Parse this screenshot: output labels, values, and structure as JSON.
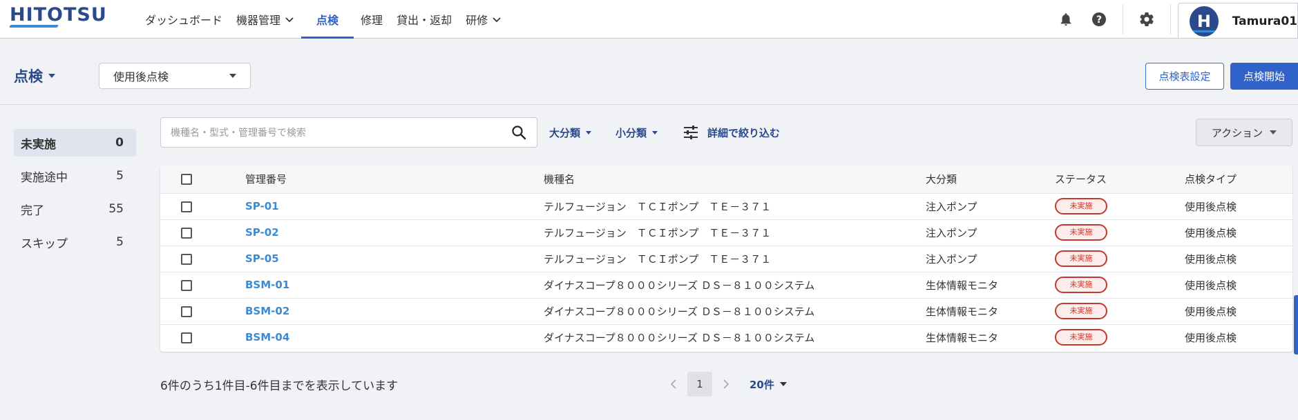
{
  "app": {
    "logo": "HITOTSU"
  },
  "nav": {
    "items": [
      {
        "label": "ダッシュボード",
        "dropdown": false,
        "active": false
      },
      {
        "label": "機器管理",
        "dropdown": true,
        "active": false
      },
      {
        "label": "点検",
        "dropdown": false,
        "active": true
      },
      {
        "label": "修理",
        "dropdown": false,
        "active": false
      },
      {
        "label": "貸出・返却",
        "dropdown": false,
        "active": false
      },
      {
        "label": "研修",
        "dropdown": true,
        "active": false
      }
    ]
  },
  "user": {
    "initial": "H",
    "name": "Tamura01"
  },
  "subheader": {
    "title": "点検",
    "inspection_type": "使用後点検",
    "settings_button": "点検表設定",
    "start_button": "点検開始"
  },
  "sidebar": {
    "items": [
      {
        "label": "未実施",
        "count": "0",
        "active": true
      },
      {
        "label": "実施途中",
        "count": "5",
        "active": false
      },
      {
        "label": "完了",
        "count": "55",
        "active": false
      },
      {
        "label": "スキップ",
        "count": "5",
        "active": false
      }
    ]
  },
  "toolbar": {
    "search_placeholder": "機種名・型式・管理番号で検索",
    "filter_major": "大分類",
    "filter_minor": "小分類",
    "filter_detail": "詳細で絞り込む",
    "action": "アクション"
  },
  "table": {
    "headers": [
      "管理番号",
      "機種名",
      "大分類",
      "ステータス",
      "点検タイプ"
    ],
    "rows": [
      [
        "SP-01",
        "テルフュージョン　ＴＣＩポンプ　ＴＥ－３７１",
        "注入ポンプ",
        "未実施",
        "使用後点検"
      ],
      [
        "SP-02",
        "テルフュージョン　ＴＣＩポンプ　ＴＥ－３７１",
        "注入ポンプ",
        "未実施",
        "使用後点検"
      ],
      [
        "SP-05",
        "テルフュージョン　ＴＣＩポンプ　ＴＥ－３７１",
        "注入ポンプ",
        "未実施",
        "使用後点検"
      ],
      [
        "BSM-01",
        "ダイナスコープ８０００シリーズ ＤＳ－８１００システム",
        "生体情報モニタ",
        "未実施",
        "使用後点検"
      ],
      [
        "BSM-02",
        "ダイナスコープ８０００シリーズ ＤＳ－８１００システム",
        "生体情報モニタ",
        "未実施",
        "使用後点検"
      ],
      [
        "BSM-04",
        "ダイナスコープ８０００シリーズ ＤＳ－８１００システム",
        "生体情報モニタ",
        "未実施",
        "使用後点検"
      ]
    ]
  },
  "footer": {
    "summary": "6件のうち1件目-6件目までを表示しています",
    "page": "1",
    "per_page": "20件"
  },
  "colors": {
    "brand": "#2b4a8c",
    "accent": "#2f63c9",
    "link": "#3a8bd6",
    "status_red": "#c0392b"
  },
  "icons": [
    "bell-icon",
    "help-icon",
    "gear-icon",
    "search-icon",
    "sliders-icon",
    "chevron-down-icon",
    "chevron-left-icon",
    "chevron-right-icon"
  ]
}
